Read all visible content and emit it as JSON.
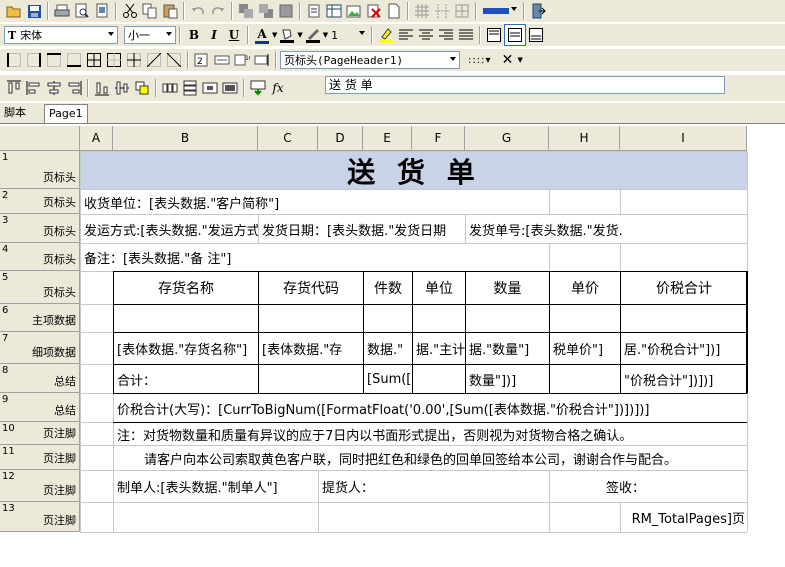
{
  "toolbar": {
    "font_name": "宋体",
    "font_size": "小一",
    "line_width": "1",
    "section": "页标头(PageHeader1)",
    "formula": "送 货 单"
  },
  "tabs": [
    "脚本",
    "Page1"
  ],
  "columns": [
    "A",
    "B",
    "C",
    "D",
    "E",
    "F",
    "G",
    "H",
    "I"
  ],
  "rows": [
    {
      "num": "1",
      "label": "页标头"
    },
    {
      "num": "2",
      "label": "页标头"
    },
    {
      "num": "3",
      "label": "页标头"
    },
    {
      "num": "4",
      "label": "页标头"
    },
    {
      "num": "5",
      "label": "页标头"
    },
    {
      "num": "6",
      "label": "主项数据"
    },
    {
      "num": "7",
      "label": "细项数据"
    },
    {
      "num": "8",
      "label": "总结"
    },
    {
      "num": "9",
      "label": "总结"
    },
    {
      "num": "10",
      "label": "页注脚"
    },
    {
      "num": "11",
      "label": "页注脚"
    },
    {
      "num": "12",
      "label": "页注脚"
    },
    {
      "num": "13",
      "label": "页注脚"
    }
  ],
  "cells": {
    "title": "送 货 单",
    "r2_b": "收货单位：[表头数据.\"客户简称\"]",
    "r3_b": "发运方式:[表头数据.\"发运方式\"",
    "r3_d": "发货日期：[表头数据.\"发货日期",
    "r3_h": "发货单号:[表头数据.\"发货.",
    "r4_b": "备注：[表头数据.\"备    注\"]",
    "r5": [
      "存货名称",
      "存货代码",
      "件数",
      "单位",
      "数量",
      "单价",
      "价税合计"
    ],
    "r7": [
      "[表体数据.\"存货名称\"]",
      "[表体数据.\"存",
      "数据.\"",
      "据.\"主计",
      "据.\"数量\"]",
      "税单价\"]",
      "居.\"价税合计\"])]"
    ],
    "r8_b": "合计：",
    "r8_e": "[Sum([",
    "r8_g": "数量\"])]",
    "r8_i": "\"价税合计\"])])]",
    "r9_b": "价税合计(大写)：[CurrToBigNum([FormatFloat('0.00',[Sum([表体数据.\"价税合计\"])])])]",
    "r10_b": "注：对货物数量和质量有异议的应于7日内以书面形式提出，否则视为对货物合格之确认。",
    "r11_b": "请客户向本公司索取黄色客户联，同时把红色和绿色的回单回签给本公司，谢谢合作与配合。",
    "r12_b": "制单人:[表头数据.\"制单人\"]",
    "r12_c": "提货人：",
    "r12_g": "签收：",
    "r13_i": "RM_TotalPages]页"
  },
  "colors": {
    "toolbar_bg": "#ece9d8",
    "title_row_bg": "#c9d3e8",
    "header_bg": "#ece9d8"
  }
}
